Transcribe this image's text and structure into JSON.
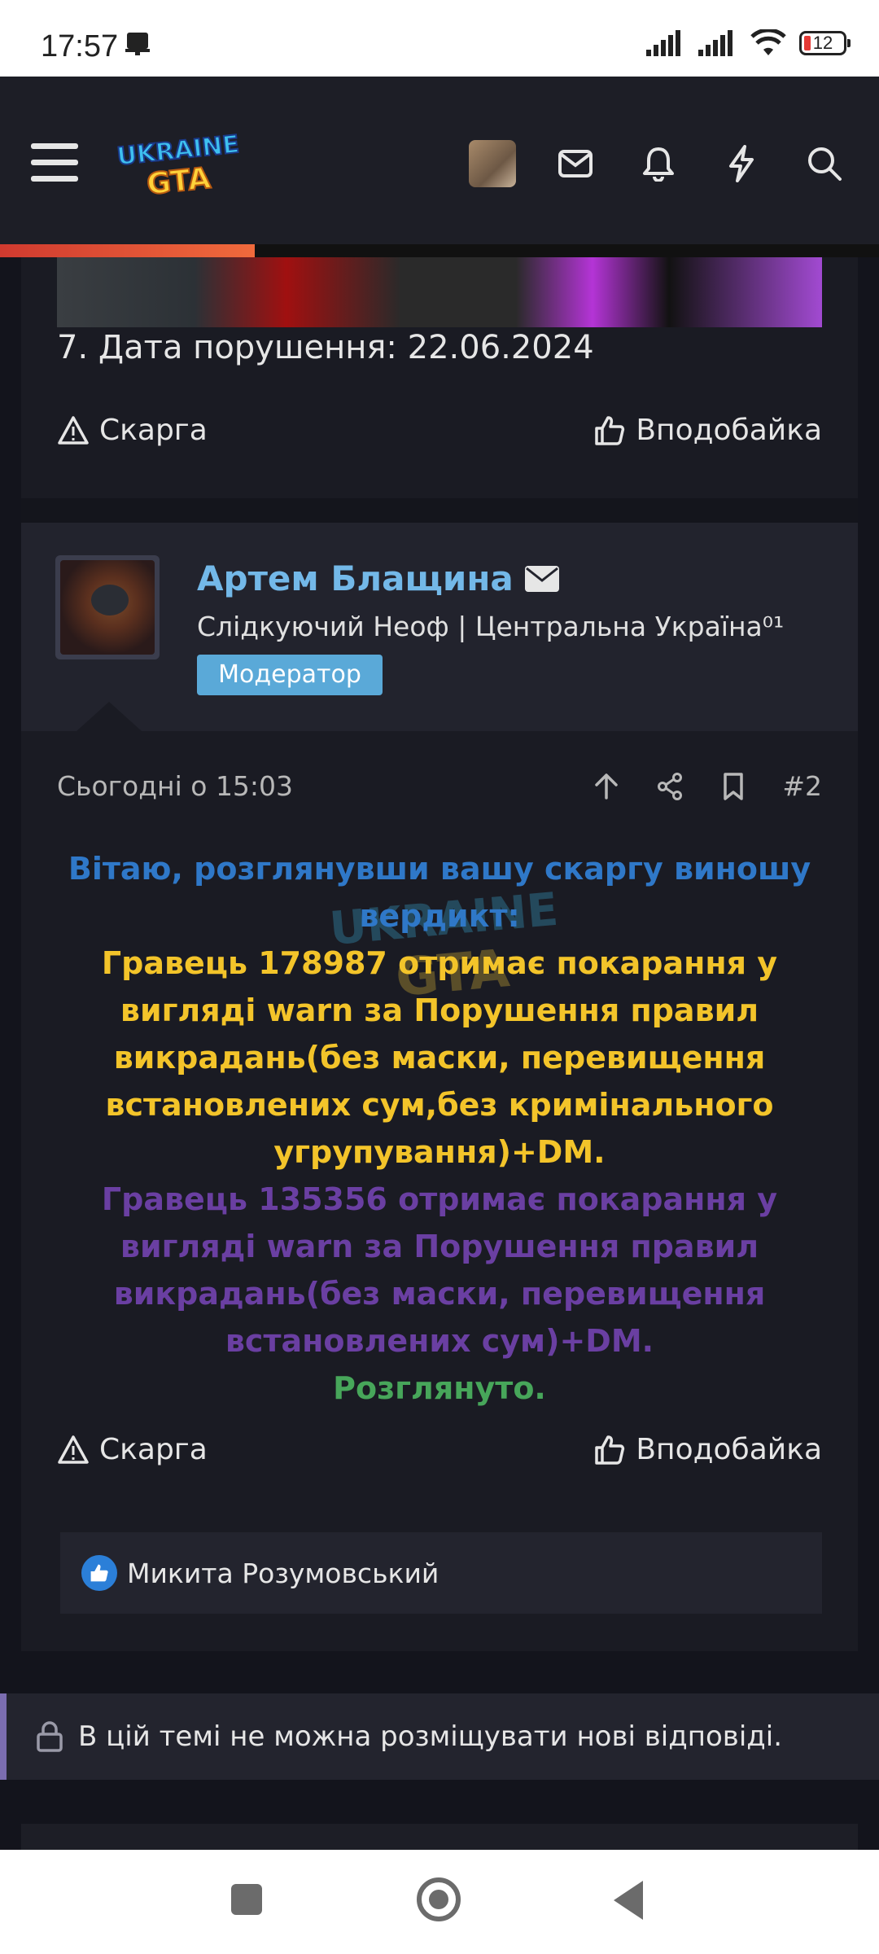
{
  "status_bar": {
    "time": "17:57",
    "battery": "12"
  },
  "header": {
    "logo_alt": "UKRAINE GTA",
    "progress_fraction": 0.29
  },
  "post1": {
    "date_line": "7. Дата порушення: 22.06.2024",
    "report_label": "Скарга",
    "like_label": "Вподобайка"
  },
  "post2": {
    "author": "Артем Блащина",
    "user_title": "Слідкуючий Неоф | Центральна Україна⁰¹",
    "role_badge": "Модератор",
    "timestamp": "Сьогодні о 15:03",
    "post_number": "#2",
    "content": {
      "greeting": "Вітаю, розглянувши вашу скаргу виношу вердикт:",
      "verdict_1": "Гравець 178987 отримає покарання у вигляді warn за Порушення правил викрадань(без маски, перевищення встановлених сум,без кримінального угрупування)+DM.",
      "verdict_2": "Гравець 135356 отримає покарання у вигляді warn за Порушення правил викрадань(без маски, перевищення встановлених сум)+DM.",
      "status": "Розглянуто."
    },
    "report_label": "Скарга",
    "like_label": "Вподобайка",
    "liked_by": "Микита Розумовський"
  },
  "thread_locked_notice": "В цій темі не можна розміщувати нові відповіді.",
  "colors": {
    "accent_blue": "#73b8e8",
    "greeting": "#2f78c8",
    "verdict_1": "#f3c42a",
    "verdict_2": "#6a3fa2",
    "status_ok": "#47a65a",
    "badge": "#5aa9d8"
  }
}
